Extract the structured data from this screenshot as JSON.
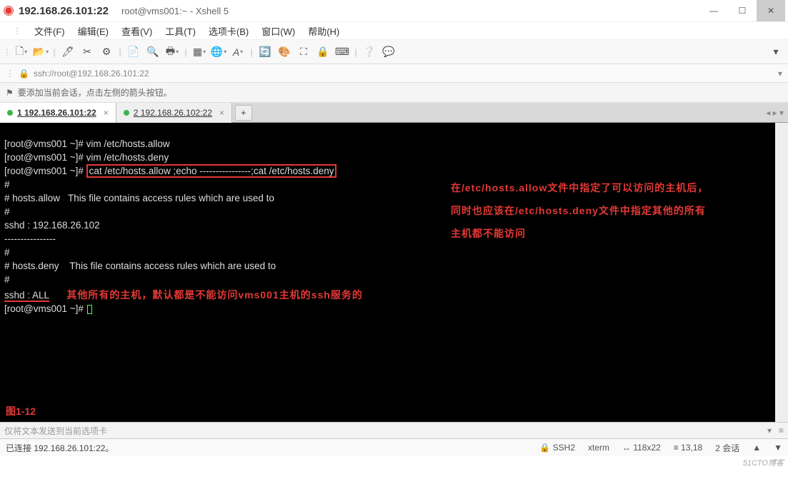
{
  "window": {
    "title_ip": "192.168.26.101:22",
    "title_host": "root@vms001:~ - Xshell 5"
  },
  "menu": {
    "file": "文件(F)",
    "edit": "编辑(E)",
    "view": "查看(V)",
    "tool": "工具(T)",
    "tabs": "选项卡(B)",
    "window": "窗口(W)",
    "help": "帮助(H)"
  },
  "addressbar": {
    "url": "ssh://root@192.168.26.101:22"
  },
  "infobar": {
    "text": "要添加当前会话，点击左侧的箭头按钮。"
  },
  "tabs": {
    "t1": "1 192.168.26.101:22",
    "t2": "2 192.168.26.102:22"
  },
  "term": {
    "l1p": "[root@vms001 ~]# ",
    "l1c": "vim /etc/hosts.allow",
    "l2p": "[root@vms001 ~]# ",
    "l2c": "vim /etc/hosts.deny",
    "l3p": "[root@vms001 ~]# ",
    "l3c": "cat /etc/hosts.allow ;echo ----------------;cat /etc/hosts.deny",
    "l4": "#",
    "l5": "# hosts.allow   This file contains access rules which are used to",
    "l6": "#",
    "l7": "sshd : 192.168.26.102",
    "l8": "----------------",
    "l9": "#",
    "l10": "# hosts.deny    This file contains access rules which are used to",
    "l11": "#",
    "l12a": "sshd : ALL",
    "l13p": "[root@vms001 ~]# ",
    "annot_right_l1": "在/etc/hosts.allow文件中指定了可以访问的主机后，",
    "annot_right_l2": "同时也应该在/etc/hosts.deny文件中指定其他的所有",
    "annot_right_l3": "主机都不能访问",
    "annot_mid": "其他所有的主机，默认都是不能访问vms001主机的ssh服务的",
    "fig": "图1-12"
  },
  "sendbar": {
    "text": "仅将文本发送到当前选项卡"
  },
  "status": {
    "conn": "已连接 192.168.26.101:22。",
    "protocol": "SSH2",
    "termtype": "xterm",
    "size": "118x22",
    "cursor": "13,18",
    "sessions": "2 会话"
  },
  "watermark": "51CTO博客"
}
